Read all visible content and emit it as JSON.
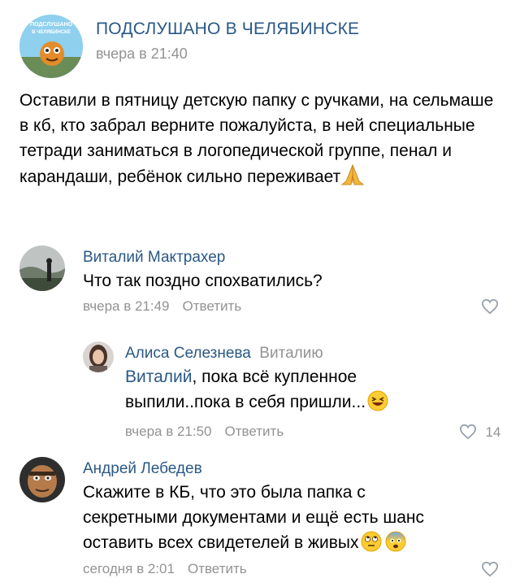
{
  "post": {
    "group_name": "ПОДСЛУШАНО В ЧЕЛЯБИНСКЕ",
    "logo_text_top": "ПОДСЛУШАНО",
    "logo_text_bottom": "В ЧЕЛЯБИНСКЕ",
    "time": "вчера в 21:40",
    "text": "Оставили в пятницу детскую папку с ручками, на сельмаше в кб, кто забрал верните пожалуйста, в ней специальные тетради заниматься в логопедической группе, пенал и карандаши, ребёнок сильно переживает",
    "text_emoji": "pray"
  },
  "comments": [
    {
      "author": "Виталий Мактрахер",
      "text": "Что так поздно спохватились?",
      "time": "вчера в 21:49",
      "reply_label": "Ответить",
      "likes": ""
    },
    {
      "author": "Алиса Селезнева",
      "reply_to": "Виталию",
      "mention": "Виталий",
      "text": ", пока всё купленное выпили..пока в себя пришли...",
      "time": "вчера в 21:50",
      "reply_label": "Ответить",
      "likes": "14"
    },
    {
      "author": "Андрей Лебедев",
      "text": "Скажите в КБ, что это была папка с секретными документами и ещё есть шанс оставить всех свидетелей в живых",
      "time": "сегодня в 2:01",
      "reply_label": "Ответить",
      "likes": ""
    }
  ],
  "colors": {
    "author": "#2a5885",
    "meta": "#939393",
    "emoji_yellow": "#ffcc33"
  }
}
